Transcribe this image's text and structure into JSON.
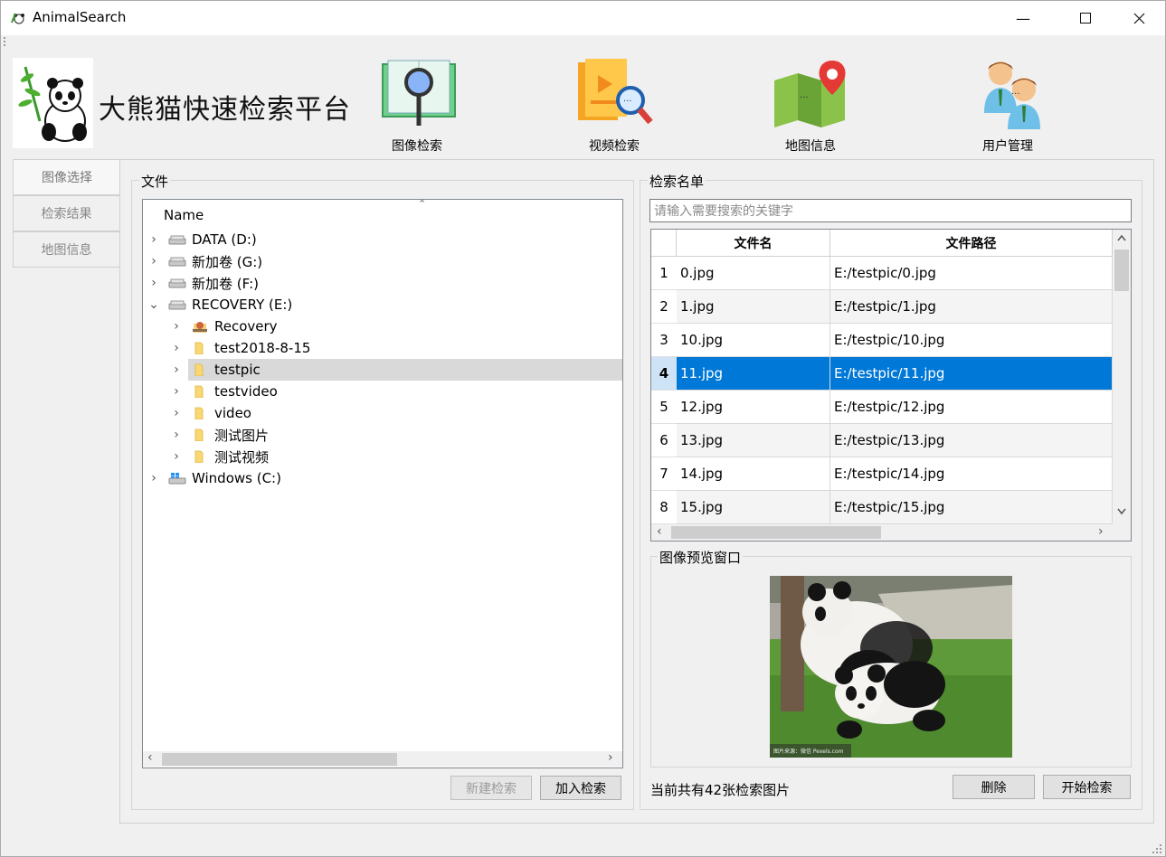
{
  "window": {
    "title": "AnimalSearch",
    "minimize_glyph": "—",
    "maximize_glyph": "☐",
    "close_glyph": "✕"
  },
  "brand": {
    "title": "大熊猫快速检索平台"
  },
  "toolbar": {
    "items": [
      {
        "label": "图像检索",
        "icon": "magnifier-book-icon"
      },
      {
        "label": "视频检索",
        "icon": "video-search-icon"
      },
      {
        "label": "地图信息",
        "icon": "map-pin-icon"
      },
      {
        "label": "用户管理",
        "icon": "users-icon"
      }
    ]
  },
  "tabs": [
    {
      "label": "图像选择",
      "active": true
    },
    {
      "label": "检索结果",
      "active": false
    },
    {
      "label": "地图信息",
      "active": false
    }
  ],
  "file_panel": {
    "legend": "文件",
    "header": "Name",
    "tree": [
      {
        "label": "DATA (D:)",
        "level": 0,
        "icon": "drive-icon",
        "expanded": false
      },
      {
        "label": "新加卷 (G:)",
        "level": 0,
        "icon": "drive-icon",
        "expanded": false
      },
      {
        "label": "新加卷 (F:)",
        "level": 0,
        "icon": "drive-icon",
        "expanded": false
      },
      {
        "label": "RECOVERY (E:)",
        "level": 0,
        "icon": "drive-icon",
        "expanded": true
      },
      {
        "label": "Recovery",
        "level": 1,
        "icon": "recovery-folder-icon",
        "expanded": false
      },
      {
        "label": "test2018-8-15",
        "level": 1,
        "icon": "folder-icon",
        "expanded": false
      },
      {
        "label": "testpic",
        "level": 1,
        "icon": "folder-icon",
        "expanded": false,
        "selected": true
      },
      {
        "label": "testvideo",
        "level": 1,
        "icon": "folder-icon",
        "expanded": false
      },
      {
        "label": "video",
        "level": 1,
        "icon": "folder-icon",
        "expanded": false
      },
      {
        "label": "测试图片",
        "level": 1,
        "icon": "folder-icon",
        "expanded": false
      },
      {
        "label": "测试视频",
        "level": 1,
        "icon": "folder-icon",
        "expanded": false
      },
      {
        "label": "Windows (C:)",
        "level": 0,
        "icon": "windows-drive-icon",
        "expanded": false
      }
    ],
    "new_search_label": "新建检索",
    "add_search_label": "加入检索"
  },
  "search_list": {
    "legend": "检索名单",
    "placeholder": "请输入需要搜索的关键字",
    "columns": [
      "文件名",
      "文件路径"
    ],
    "rows": [
      {
        "num": "1",
        "name": "0.jpg",
        "path": "E:/testpic/0.jpg"
      },
      {
        "num": "2",
        "name": "1.jpg",
        "path": "E:/testpic/1.jpg"
      },
      {
        "num": "3",
        "name": "10.jpg",
        "path": "E:/testpic/10.jpg"
      },
      {
        "num": "4",
        "name": "11.jpg",
        "path": "E:/testpic/11.jpg",
        "selected": true
      },
      {
        "num": "5",
        "name": "12.jpg",
        "path": "E:/testpic/12.jpg"
      },
      {
        "num": "6",
        "name": "13.jpg",
        "path": "E:/testpic/13.jpg"
      },
      {
        "num": "7",
        "name": "14.jpg",
        "path": "E:/testpic/14.jpg"
      },
      {
        "num": "8",
        "name": "15.jpg",
        "path": "E:/testpic/15.jpg"
      }
    ]
  },
  "preview": {
    "legend": "图像预览窗口",
    "watermark": "图片来源：微信 Pexels.com"
  },
  "status": {
    "text": "当前共有42张检索图片",
    "delete_label": "删除",
    "start_label": "开始检索"
  },
  "colors": {
    "selection": "#0078d7",
    "tree_selection": "#d9d9d9"
  }
}
